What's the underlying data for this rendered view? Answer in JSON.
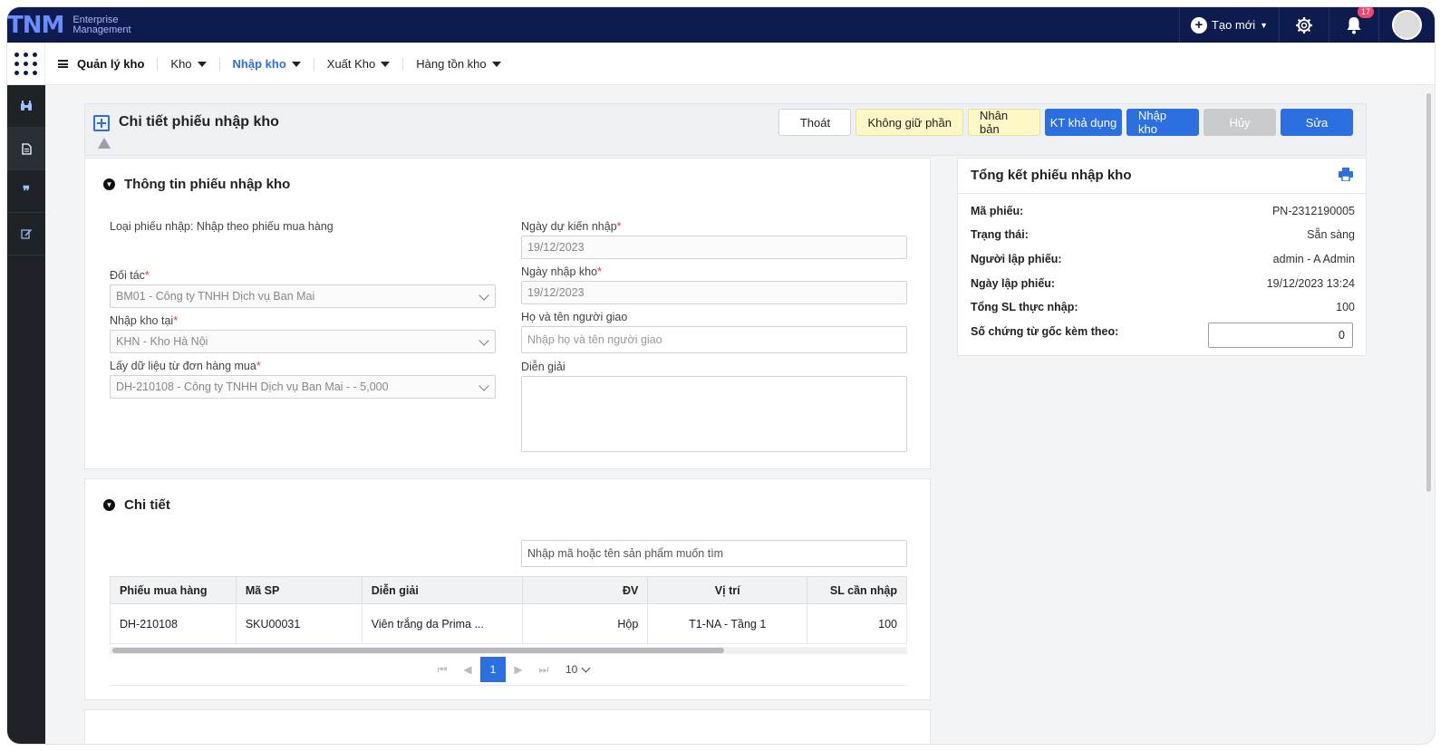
{
  "app": {
    "logo": "TNM",
    "subtitle_line1": "Enterprise",
    "subtitle_line2": "Management"
  },
  "topbar": {
    "create_label": "Tạo mới",
    "notification_count": "17"
  },
  "nav": {
    "title": "Quản lý kho",
    "items": [
      {
        "label": "Kho",
        "active": false
      },
      {
        "label": "Nhập kho",
        "active": true
      },
      {
        "label": "Xuất Kho",
        "active": false
      },
      {
        "label": "Hàng tồn kho",
        "active": false
      }
    ]
  },
  "sidebar": {
    "icons": [
      "binoculars-icon",
      "document-icon",
      "quote-icon",
      "edit-icon"
    ]
  },
  "header": {
    "title": "Chi tiết phiếu nhập kho",
    "actions": {
      "exit": "Thoát",
      "no_hold": "Không giữ phần",
      "duplicate": "Nhân bản",
      "check_available": "KT khả dụng",
      "receive": "Nhập kho",
      "cancel": "Hủy",
      "edit": "Sửa"
    }
  },
  "info": {
    "section_title": "Thông tin phiếu nhập kho",
    "receipt_type": "Loại phiếu nhập: Nhập theo phiếu mua hàng",
    "partner_label": "Đối tác",
    "partner_value": "BM01 - Công ty TNHH Dịch vụ Ban Mai",
    "warehouse_label": "Nhập kho tại",
    "warehouse_value": "KHN - Kho Hà Nội",
    "po_label": "Lấy dữ liệu từ đơn hàng mua",
    "po_value": "DH-210108 - Công ty TNHH Dịch vụ Ban Mai - - 5,000",
    "expected_date_label": "Ngày dự kiến nhập",
    "expected_date_value": "19/12/2023",
    "receipt_date_label": "Ngày nhập kho",
    "receipt_date_value": "19/12/2023",
    "deliverer_label": "Họ và tên người giao",
    "deliverer_placeholder": "Nhập họ và tên người giao",
    "description_label": "Diễn giải",
    "required_mark": "*"
  },
  "detail": {
    "section_title": "Chi tiết",
    "search_placeholder": "Nhập mã hoặc tên sản phẩm muốn tìm",
    "columns": [
      "Phiếu mua hàng",
      "Mã SP",
      "Diễn giải",
      "ĐV",
      "Vị trí",
      "SL cần nhập"
    ],
    "rows": [
      {
        "po": "DH-210108",
        "sku": "SKU00031",
        "desc": "Viên trắng da Prima ...",
        "unit": "Hộp",
        "location": "T1-NA - Tầng 1",
        "qty": "100"
      }
    ],
    "pagination": {
      "current_page": "1",
      "page_size": "10"
    }
  },
  "summary": {
    "title": "Tổng kết phiếu nhập kho",
    "rows": [
      {
        "key": "Mã phiếu:",
        "value": "PN-2312190005"
      },
      {
        "key": "Trạng thái:",
        "value": "Sẵn sàng"
      },
      {
        "key": "Người lập phiếu:",
        "value": "admin - A Admin"
      },
      {
        "key": "Ngày lập phiếu:",
        "value": "19/12/2023 13:24"
      },
      {
        "key": "Tổng SL thực nhập:",
        "value": "100"
      }
    ],
    "attachments_label": "Số chứng từ gốc kèm theo:",
    "attachments_value": "0"
  }
}
